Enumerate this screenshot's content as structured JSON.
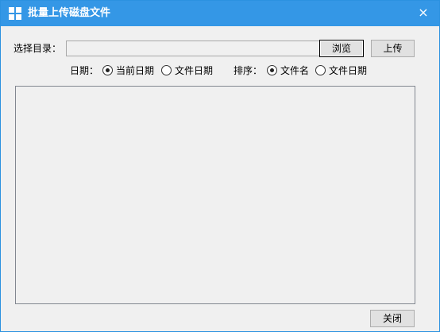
{
  "window": {
    "title": "批量上传磁盘文件",
    "close_glyph": "×",
    "accent": "#3497e6"
  },
  "directory": {
    "label": "选择目录：",
    "value": "",
    "browse_label": "浏览",
    "upload_label": "上传"
  },
  "date": {
    "label": "日期：",
    "options": [
      {
        "label": "当前日期",
        "selected": true
      },
      {
        "label": "文件日期",
        "selected": false
      }
    ]
  },
  "sort": {
    "label": "排序：",
    "options": [
      {
        "label": "文件名",
        "selected": true
      },
      {
        "label": "文件日期",
        "selected": false
      }
    ]
  },
  "footer": {
    "close_label": "关闭"
  },
  "icons": {
    "app": "windows-grid-icon",
    "close": "close-icon"
  }
}
